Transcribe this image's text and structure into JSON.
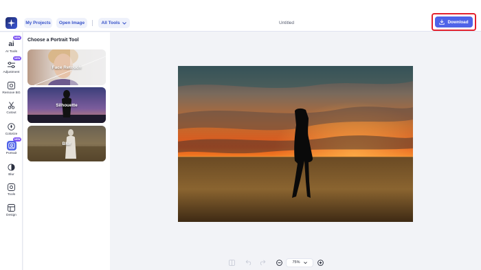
{
  "header": {
    "my_projects": "My Projects",
    "open_image": "Open Image",
    "all_tools": "All Tools",
    "doc_title": "Untitled",
    "download": "Download"
  },
  "rail": {
    "items": [
      {
        "label": "AI Tools",
        "icon": "ai-icon",
        "badge": "NEW"
      },
      {
        "label": "Adjustment",
        "icon": "sliders-icon",
        "badge": "NEW"
      },
      {
        "label": "Remove BG",
        "icon": "remove-bg-icon"
      },
      {
        "label": "Cutout",
        "icon": "scissors-icon"
      },
      {
        "label": "Colorize",
        "icon": "colorize-icon"
      },
      {
        "label": "Portrait",
        "icon": "portrait-icon",
        "badge": "NEW"
      },
      {
        "label": "Blur",
        "icon": "blur-icon"
      },
      {
        "label": "Tools",
        "icon": "tools-icon"
      },
      {
        "label": "Design",
        "icon": "design-icon"
      }
    ]
  },
  "panel": {
    "title": "Choose a Portrait Tool",
    "cards": [
      {
        "label": "Face Retouch"
      },
      {
        "label": "Silhouette"
      },
      {
        "label": "Blur"
      }
    ]
  },
  "zoom": {
    "level": "75%"
  },
  "colors": {
    "accent": "#4f63e8",
    "highlight": "#e3202c",
    "badge": "#7a4ff0"
  }
}
